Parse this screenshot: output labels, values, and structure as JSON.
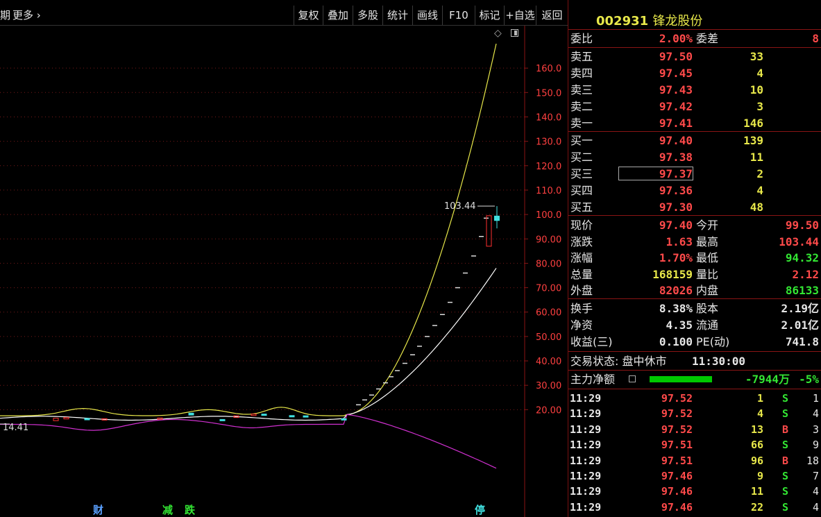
{
  "toolbar": {
    "left_partial": "期",
    "more": "更多",
    "buttons": [
      "复权",
      "叠加",
      "多股",
      "统计",
      "画线",
      "F10",
      "标记",
      "+自选",
      "返回"
    ]
  },
  "stock": {
    "code": "002931",
    "name": "锋龙股份"
  },
  "order_book": {
    "weibi_label": "委比",
    "weibi": "2.00%",
    "weicha_label": "委差",
    "weicha": "8",
    "asks": [
      {
        "label": "卖五",
        "price": "97.50",
        "vol": "33"
      },
      {
        "label": "卖四",
        "price": "97.45",
        "vol": "4"
      },
      {
        "label": "卖三",
        "price": "97.43",
        "vol": "10"
      },
      {
        "label": "卖二",
        "price": "97.42",
        "vol": "3"
      },
      {
        "label": "卖一",
        "price": "97.41",
        "vol": "146"
      }
    ],
    "bids": [
      {
        "label": "买一",
        "price": "97.40",
        "vol": "139"
      },
      {
        "label": "买二",
        "price": "97.38",
        "vol": "11"
      },
      {
        "label": "买三",
        "price": "97.37",
        "vol": "2"
      },
      {
        "label": "买四",
        "price": "97.36",
        "vol": "4"
      },
      {
        "label": "买五",
        "price": "97.30",
        "vol": "48"
      }
    ]
  },
  "quote": [
    {
      "l": "现价",
      "v": "97.40",
      "vc": "r",
      "l2": "今开",
      "v2": "99.50",
      "v2c": "r"
    },
    {
      "l": "涨跌",
      "v": "1.63",
      "vc": "r",
      "l2": "最高",
      "v2": "103.44",
      "v2c": "r"
    },
    {
      "l": "涨幅",
      "v": "1.70%",
      "vc": "r",
      "l2": "最低",
      "v2": "94.32",
      "v2c": "g"
    },
    {
      "l": "总量",
      "v": "168159",
      "vc": "y",
      "l2": "量比",
      "v2": "2.12",
      "v2c": "r"
    },
    {
      "l": "外盘",
      "v": "82026",
      "vc": "r",
      "l2": "内盘",
      "v2": "86133",
      "v2c": "g"
    }
  ],
  "stats": [
    {
      "l": "换手",
      "v": "8.38%",
      "l2": "股本",
      "v2": "2.19亿"
    },
    {
      "l": "净资",
      "v": "4.35",
      "l2": "流通",
      "v2": "2.01亿"
    },
    {
      "l": "收益(三)",
      "v": "0.100",
      "l2": "PE(动)",
      "v2": "741.8"
    }
  ],
  "trade_status": {
    "label": "交易状态:",
    "value": "盘中休市",
    "time": "11:30:00"
  },
  "main_flow": {
    "label": "主力净额",
    "value": "-7944万",
    "pct": "-5%",
    "bar_fraction": 0.6
  },
  "ticks": [
    {
      "t": "11:29",
      "p": "97.52",
      "v": "1",
      "d": "S",
      "n": "1"
    },
    {
      "t": "11:29",
      "p": "97.52",
      "v": "4",
      "d": "S",
      "n": "4"
    },
    {
      "t": "11:29",
      "p": "97.52",
      "v": "13",
      "d": "B",
      "n": "3"
    },
    {
      "t": "11:29",
      "p": "97.51",
      "v": "66",
      "d": "S",
      "n": "9"
    },
    {
      "t": "11:29",
      "p": "97.51",
      "v": "96",
      "d": "B",
      "n": "18"
    },
    {
      "t": "11:29",
      "p": "97.46",
      "v": "9",
      "d": "S",
      "n": "7"
    },
    {
      "t": "11:29",
      "p": "97.46",
      "v": "11",
      "d": "S",
      "n": "4"
    },
    {
      "t": "11:29",
      "p": "97.46",
      "v": "22",
      "d": "S",
      "n": "4"
    }
  ],
  "chart_data": {
    "type": "candlestick",
    "y_ticks": [
      "160.0",
      "150.0",
      "140.0",
      "130.0",
      "120.0",
      "110.0",
      "100.0",
      "90.00",
      "80.00",
      "70.00",
      "60.00",
      "50.00",
      "40.00",
      "30.00",
      "20.00"
    ],
    "ylim": [
      12,
      170
    ],
    "max_label": "103.44",
    "min_label": "14.41",
    "colors": {
      "up": "#ff3030",
      "down": "#40e0e0",
      "ma_upper": "#e8e84a",
      "ma_mid": "#ffffff",
      "ma_lower": "#d030d0",
      "grid": "#7a1a1a"
    },
    "markers": [
      {
        "text": "财",
        "color": "#5aa0ff"
      },
      {
        "text": "减",
        "color": "#33e633"
      },
      {
        "text": "跌",
        "color": "#33e633"
      },
      {
        "text": "停",
        "color": "#40e0e0"
      }
    ]
  }
}
